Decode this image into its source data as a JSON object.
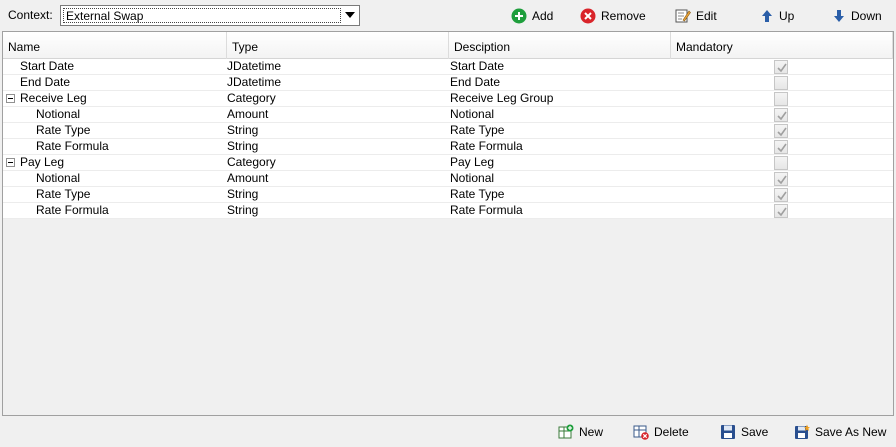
{
  "toolbar": {
    "context_label": "Context:",
    "context_value": "External Swap",
    "add_label": "Add",
    "remove_label": "Remove",
    "edit_label": "Edit",
    "up_label": "Up",
    "down_label": "Down"
  },
  "grid": {
    "columns": [
      "Name",
      "Type",
      "Desciption",
      "Mandatory"
    ],
    "rows": [
      {
        "name": "Start Date",
        "type": "JDatetime",
        "desc": "Start Date",
        "mandatory": true
      },
      {
        "name": "End Date",
        "type": "JDatetime",
        "desc": "End Date",
        "mandatory": false
      },
      {
        "name": "Receive Leg",
        "type": "Category",
        "desc": "Receive Leg Group",
        "mandatory": false
      },
      {
        "name": "Notional",
        "type": "Amount",
        "desc": "Notional",
        "mandatory": true
      },
      {
        "name": "Rate Type",
        "type": "String",
        "desc": "Rate Type",
        "mandatory": true
      },
      {
        "name": "Rate Formula",
        "type": "String",
        "desc": "Rate Formula",
        "mandatory": true
      },
      {
        "name": "Pay Leg",
        "type": "Category",
        "desc": "Pay Leg",
        "mandatory": false
      },
      {
        "name": "Notional",
        "type": "Amount",
        "desc": "Notional",
        "mandatory": true
      },
      {
        "name": "Rate Type",
        "type": "String",
        "desc": "Rate Type",
        "mandatory": true
      },
      {
        "name": "Rate Formula",
        "type": "String",
        "desc": "Rate Formula",
        "mandatory": true
      }
    ]
  },
  "footer": {
    "new_label": "New",
    "delete_label": "Delete",
    "save_label": "Save",
    "save_as_new_label": "Save As New"
  },
  "colors": {
    "add_green": "#1e9e3c",
    "remove_red": "#d9242a",
    "arrow_blue": "#2a5ea8",
    "check_gray": "#a0a0a0"
  }
}
